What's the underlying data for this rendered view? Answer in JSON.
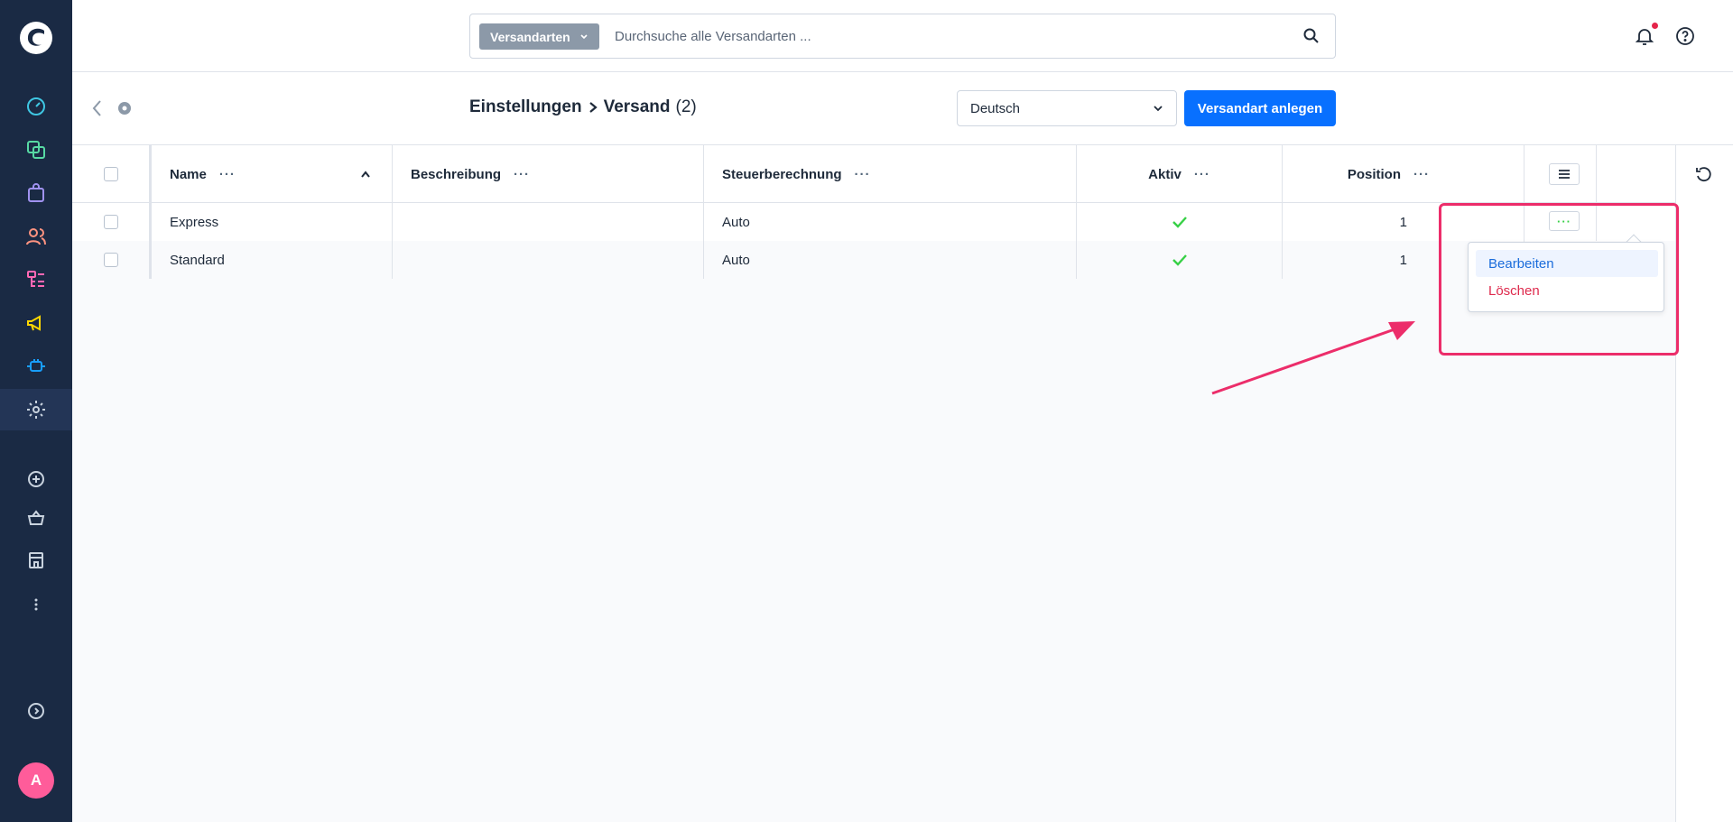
{
  "app": {
    "logo": "shopware-logo-icon",
    "avatar_initial": "A"
  },
  "colors": {
    "sidebar_bg": "#1a2a44",
    "primary": "#0870ff",
    "success": "#37d046",
    "danger": "#de294c",
    "annotation": "#ec2d6a"
  },
  "sidebar": {
    "items": [
      {
        "name": "dashboard",
        "icon": "gauge-icon"
      },
      {
        "name": "catalogues",
        "icon": "layers-icon"
      },
      {
        "name": "orders",
        "icon": "shopping-bag-icon"
      },
      {
        "name": "customers",
        "icon": "users-icon"
      },
      {
        "name": "content",
        "icon": "content-list-icon"
      },
      {
        "name": "marketing",
        "icon": "megaphone-icon"
      },
      {
        "name": "extensions",
        "icon": "plugin-icon"
      },
      {
        "name": "settings",
        "icon": "gear-icon",
        "active": true
      },
      {
        "name": "add-sales-channel",
        "icon": "plus-circle-icon"
      },
      {
        "name": "storefront",
        "icon": "basket-icon"
      },
      {
        "name": "headless",
        "icon": "store-icon"
      },
      {
        "name": "more",
        "icon": "more-vertical-icon"
      },
      {
        "name": "expand",
        "icon": "chevron-circle-right-icon"
      }
    ]
  },
  "search": {
    "type_label": "Versandarten",
    "placeholder": "Durchsuche alle Versandarten ..."
  },
  "header": {
    "breadcrumb_parent": "Einstellungen",
    "breadcrumb_current": "Versand",
    "count": "(2)",
    "language": "Deutsch",
    "create_button": "Versandart anlegen"
  },
  "grid": {
    "columns": [
      {
        "label": "Name",
        "sort": "ascending"
      },
      {
        "label": "Beschreibung"
      },
      {
        "label": "Steuerberechnung"
      },
      {
        "label": "Aktiv"
      },
      {
        "label": "Position"
      }
    ],
    "rows": [
      {
        "name": "Express",
        "description": "",
        "tax": "Auto",
        "active": true,
        "position": "1"
      },
      {
        "name": "Standard",
        "description": "",
        "tax": "Auto",
        "active": true,
        "position": "1"
      }
    ],
    "dots": "···"
  },
  "context_menu": {
    "edit": "Bearbeiten",
    "delete": "Löschen"
  }
}
